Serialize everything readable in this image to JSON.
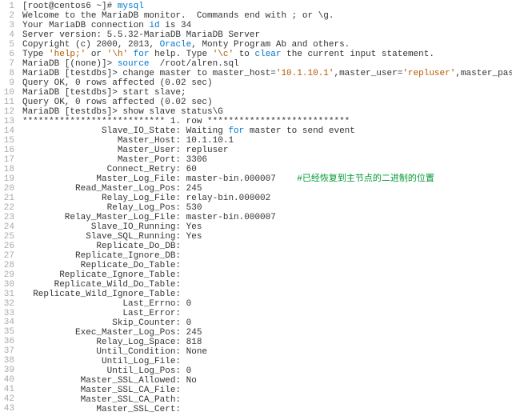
{
  "lines": [
    {
      "segments": [
        {
          "t": "[root@centos6 ~]# ",
          "c": "blk"
        },
        {
          "t": "mysql",
          "c": "blu"
        }
      ]
    },
    {
      "segments": [
        {
          "t": "Welcome to the MariaDB monitor.  Commands end with ; or \\g.",
          "c": "blk"
        }
      ]
    },
    {
      "segments": [
        {
          "t": "Your MariaDB connection ",
          "c": "blk"
        },
        {
          "t": "id",
          "c": "blu"
        },
        {
          "t": " is 34",
          "c": "blk"
        }
      ]
    },
    {
      "segments": [
        {
          "t": "Server version: 5.5.32-MariaDB MariaDB Server",
          "c": "blk"
        }
      ]
    },
    {
      "segments": [
        {
          "t": "Copyright (c) 2000, 2013, ",
          "c": "blk"
        },
        {
          "t": "Oracle",
          "c": "blu"
        },
        {
          "t": ", Monty Program Ab and others.",
          "c": "blk"
        }
      ]
    },
    {
      "segments": [
        {
          "t": "Type ",
          "c": "blk"
        },
        {
          "t": "'help;'",
          "c": "str"
        },
        {
          "t": " or ",
          "c": "blk"
        },
        {
          "t": "'\\h'",
          "c": "str"
        },
        {
          "t": " ",
          "c": "blk"
        },
        {
          "t": "for",
          "c": "blu"
        },
        {
          "t": " help. Type ",
          "c": "blk"
        },
        {
          "t": "'\\c'",
          "c": "str"
        },
        {
          "t": " to ",
          "c": "blk"
        },
        {
          "t": "clear",
          "c": "blu"
        },
        {
          "t": " the current input statement.",
          "c": "blk"
        }
      ]
    },
    {
      "segments": [
        {
          "t": "MariaDB [(none)]> ",
          "c": "blk"
        },
        {
          "t": "source",
          "c": "blu"
        },
        {
          "t": "  /root/alren.sql",
          "c": "blk"
        }
      ]
    },
    {
      "segments": [
        {
          "t": "MariaDB [testdbs]> change master to master_host=",
          "c": "blk"
        },
        {
          "t": "'10.1.10.1'",
          "c": "str"
        },
        {
          "t": ",master_user=",
          "c": "blk"
        },
        {
          "t": "'repluser'",
          "c": "str"
        },
        {
          "t": ",master_passwo",
          "c": "blk"
        }
      ]
    },
    {
      "segments": [
        {
          "t": "Query OK, 0 rows affected (0.02 sec)",
          "c": "blk"
        }
      ]
    },
    {
      "segments": [
        {
          "t": "MariaDB [testdbs]> start slave;",
          "c": "blk"
        }
      ]
    },
    {
      "segments": [
        {
          "t": "Query OK, 0 rows affected (0.02 sec)",
          "c": "blk"
        }
      ]
    },
    {
      "segments": [
        {
          "t": "MariaDB [testdbs]> show slave status\\G",
          "c": "blk"
        }
      ]
    },
    {
      "segments": [
        {
          "t": "*************************** 1. row ***************************",
          "c": "blk"
        }
      ]
    },
    {
      "segments": [
        {
          "t": "               Slave_IO_State: Waiting ",
          "c": "blk"
        },
        {
          "t": "for",
          "c": "blu"
        },
        {
          "t": " master to send event",
          "c": "blk"
        }
      ]
    },
    {
      "segments": [
        {
          "t": "                  Master_Host: 10.1.10.1",
          "c": "blk"
        }
      ]
    },
    {
      "segments": [
        {
          "t": "                  Master_User: repluser",
          "c": "blk"
        }
      ]
    },
    {
      "segments": [
        {
          "t": "                  Master_Port: 3306",
          "c": "blk"
        }
      ]
    },
    {
      "segments": [
        {
          "t": "                Connect_Retry: 60",
          "c": "blk"
        }
      ]
    },
    {
      "segments": [
        {
          "t": "              Master_Log_File: master-bin.000007    ",
          "c": "blk"
        },
        {
          "t": "#已经恢复到主节点的二进制的位置",
          "c": "grn"
        }
      ]
    },
    {
      "segments": [
        {
          "t": "          Read_Master_Log_Pos: 245",
          "c": "blk"
        }
      ]
    },
    {
      "segments": [
        {
          "t": "               Relay_Log_File: relay-bin.000002",
          "c": "blk"
        }
      ]
    },
    {
      "segments": [
        {
          "t": "                Relay_Log_Pos: 530",
          "c": "blk"
        }
      ]
    },
    {
      "segments": [
        {
          "t": "        Relay_Master_Log_File: master-bin.000007",
          "c": "blk"
        }
      ]
    },
    {
      "segments": [
        {
          "t": "             Slave_IO_Running: Yes",
          "c": "blk"
        }
      ]
    },
    {
      "segments": [
        {
          "t": "            Slave_SQL_Running: Yes",
          "c": "blk"
        }
      ]
    },
    {
      "segments": [
        {
          "t": "              Replicate_Do_DB:",
          "c": "blk"
        }
      ]
    },
    {
      "segments": [
        {
          "t": "          Replicate_Ignore_DB:",
          "c": "blk"
        }
      ]
    },
    {
      "segments": [
        {
          "t": "           Replicate_Do_Table:",
          "c": "blk"
        }
      ]
    },
    {
      "segments": [
        {
          "t": "       Replicate_Ignore_Table:",
          "c": "blk"
        }
      ]
    },
    {
      "segments": [
        {
          "t": "      Replicate_Wild_Do_Table:",
          "c": "blk"
        }
      ]
    },
    {
      "segments": [
        {
          "t": "  Replicate_Wild_Ignore_Table:",
          "c": "blk"
        }
      ]
    },
    {
      "segments": [
        {
          "t": "                   Last_Errno: 0",
          "c": "blk"
        }
      ]
    },
    {
      "segments": [
        {
          "t": "                   Last_Error:",
          "c": "blk"
        }
      ]
    },
    {
      "segments": [
        {
          "t": "                 Skip_Counter: 0",
          "c": "blk"
        }
      ]
    },
    {
      "segments": [
        {
          "t": "          Exec_Master_Log_Pos: 245",
          "c": "blk"
        }
      ]
    },
    {
      "segments": [
        {
          "t": "              Relay_Log_Space: 818",
          "c": "blk"
        }
      ]
    },
    {
      "segments": [
        {
          "t": "              Until_Condition: None",
          "c": "blk"
        }
      ]
    },
    {
      "segments": [
        {
          "t": "               Until_Log_File:",
          "c": "blk"
        }
      ]
    },
    {
      "segments": [
        {
          "t": "                Until_Log_Pos: 0",
          "c": "blk"
        }
      ]
    },
    {
      "segments": [
        {
          "t": "           Master_SSL_Allowed: No",
          "c": "blk"
        }
      ]
    },
    {
      "segments": [
        {
          "t": "           Master_SSL_CA_File:",
          "c": "blk"
        }
      ]
    },
    {
      "segments": [
        {
          "t": "           Master_SSL_CA_Path:",
          "c": "blk"
        }
      ]
    },
    {
      "segments": [
        {
          "t": "              Master_SSL_Cert:",
          "c": "blk"
        }
      ]
    }
  ]
}
